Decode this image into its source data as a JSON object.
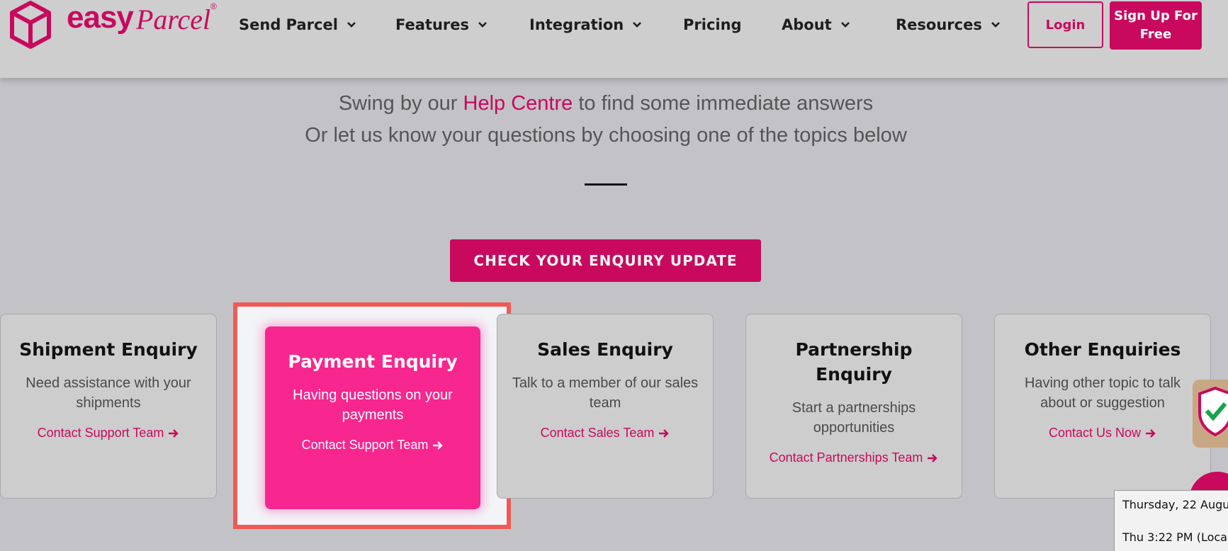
{
  "header": {
    "logo": {
      "easy": "easy",
      "parcel": "Parcel",
      "reg": "®"
    },
    "nav": [
      {
        "label": "Send Parcel",
        "dropdown": true
      },
      {
        "label": "Features",
        "dropdown": true
      },
      {
        "label": "Integration",
        "dropdown": true
      },
      {
        "label": "Pricing",
        "dropdown": false
      },
      {
        "label": "About",
        "dropdown": true
      },
      {
        "label": "Resources",
        "dropdown": true
      }
    ],
    "login_label": "Login",
    "signup_label": "Sign Up For Free"
  },
  "intro": {
    "line1_before": "Swing by our ",
    "help_link": "Help Centre",
    "line1_after": " to find some immediate answers",
    "line2": "Or let us know your questions by choosing one of the topics below"
  },
  "check_button_label": "CHECK YOUR ENQUIRY UPDATE",
  "cards": [
    {
      "title": "Shipment Enquiry",
      "desc": "Need assistance with your shipments",
      "link": "Contact Support Team"
    },
    {
      "title": "Payment Enquiry",
      "desc": "Having questions on your payments",
      "link": "Contact Support Team",
      "highlighted": true
    },
    {
      "title": "Sales Enquiry",
      "desc": "Talk to a member of our sales team",
      "link": "Contact Sales Team"
    },
    {
      "title": "Partnership Enquiry",
      "desc": "Start a partnerships opportunities",
      "link": "Contact Partnerships Team"
    },
    {
      "title": "Other Enquiries",
      "desc": "Having other topic to talk about or suggestion",
      "link": "Contact Us Now"
    }
  ],
  "tooltip": {
    "date": "Thursday, 22 Augu",
    "time": "Thu 3:22 PM (Loca"
  },
  "colors": {
    "brand": "#c9095e",
    "active_card": "#f8268f",
    "highlight_border": "#f05a55"
  },
  "icons": {
    "nav_dropdown": "chevron-down-icon",
    "link_arrow": "arrow-right-icon",
    "logo": "box-icon"
  }
}
